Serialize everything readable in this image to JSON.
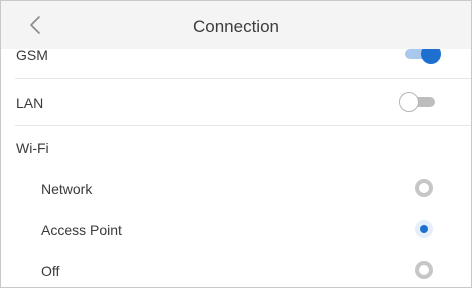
{
  "header": {
    "title": "Connection",
    "back_icon": "chevron-left-icon"
  },
  "settings": {
    "gsm": {
      "label": "GSM",
      "enabled": true
    },
    "lan": {
      "label": "LAN",
      "enabled": false
    },
    "wifi": {
      "label": "Wi-Fi",
      "options": [
        {
          "label": "Network",
          "selected": false
        },
        {
          "label": "Access Point",
          "selected": true
        },
        {
          "label": "Off",
          "selected": false
        }
      ]
    }
  },
  "colors": {
    "accent": "#1e70d0",
    "accent_light": "#a9c8ee",
    "header_bg": "#f4f4f4",
    "divider": "#e6e6e6"
  }
}
